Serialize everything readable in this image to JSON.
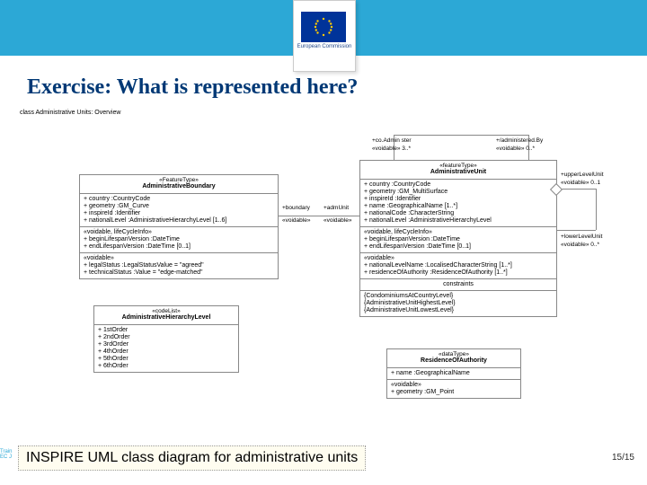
{
  "brand": {
    "logo_label": "European\nCommission"
  },
  "title": "Exercise: What is represented here?",
  "overview_label": "class Administrative Units: Overview",
  "answer": "INSPIRE UML class diagram for administrative units",
  "page": "15/15",
  "footer_partial": "Train\nEC J",
  "labels": {
    "coAdmin": "+co.Admin ster",
    "coAdmin_m": "«voidable» 3..*",
    "administeredBy": "+/administered.By",
    "administeredBy_m": "«voidable» 0..*",
    "upperUnit": "+upperLevelUnit",
    "upperUnit_m": "«voidable» 0..1",
    "lowerUnit": "+lowerLevelUnit",
    "lowerUnit_m": "«voidable» 0..*",
    "boundary": "+boundary",
    "boundary_m": "«voidable»",
    "admUnit": "+admUnit",
    "admUnit_m": "«voidable»"
  },
  "boxes": {
    "admBoundary": {
      "stereo": "«FeatureType»",
      "name": "AdministrativeBoundary",
      "attrs1": [
        "+ country :CountryCode",
        "+ geometry :GM_Curve",
        "+ inspireId :Identifier",
        "+ nationalLevel :AdministrativeHierarchyLevel [1..6]"
      ],
      "group1": "«voidable, lifeCycleInfo»",
      "attrs2": [
        "+ beginLifespanVersion :DateTime",
        "+ endLifespanVersion :DateTime [0..1]"
      ],
      "group2": "«voidable»",
      "attrs3": [
        "+ legalStatus :LegalStatusValue = \"agreed\"",
        "+ technicalStatus :Value = \"edge-matched\""
      ]
    },
    "admUnit": {
      "stereo": "«featureType»",
      "name": "AdministrativeUnit",
      "attrs1": [
        "+ country :CountryCode",
        "+ geometry :GM_MultiSurface",
        "+ inspireId :Identifier",
        "+ name :GeographicalName [1..*]",
        "+ nationalCode :CharacterString",
        "+ nationalLevel :AdministrativeHierarchyLevel"
      ],
      "group1": "«voidable, lifeCycleInfo»",
      "attrs2": [
        "+ beginLifespanVersion :DateTime",
        "+ endLifespanVersion :DateTime [0..1]"
      ],
      "group2": "«voidable»",
      "attrs3": [
        "+ nationalLevelName :LocalisedCharacterString [1..*]",
        "+ residenceOfAuthority :ResidenceOfAuthority [1..*]"
      ],
      "constraints_head": "constraints",
      "constraints": [
        "{CondominiumsAtCountryLevel}",
        "{AdministrativeUnitHighestLevel}",
        "{AdministrativeUnitLowestLevel}"
      ]
    },
    "hier": {
      "stereo": "«codeList»",
      "name": "AdministrativeHierarchyLevel",
      "items": [
        "+ 1stOrder",
        "+ 2ndOrder",
        "+ 3rdOrder",
        "+ 4thOrder",
        "+ 5thOrder",
        "+ 6thOrder"
      ]
    },
    "residence": {
      "stereo": "«dataType»",
      "name": "ResidenceOfAuthority",
      "attrs1": [
        "+ name :GeographicalName"
      ],
      "group1": "«voidable»",
      "attrs2": [
        "+ geometry :GM_Point"
      ]
    }
  }
}
